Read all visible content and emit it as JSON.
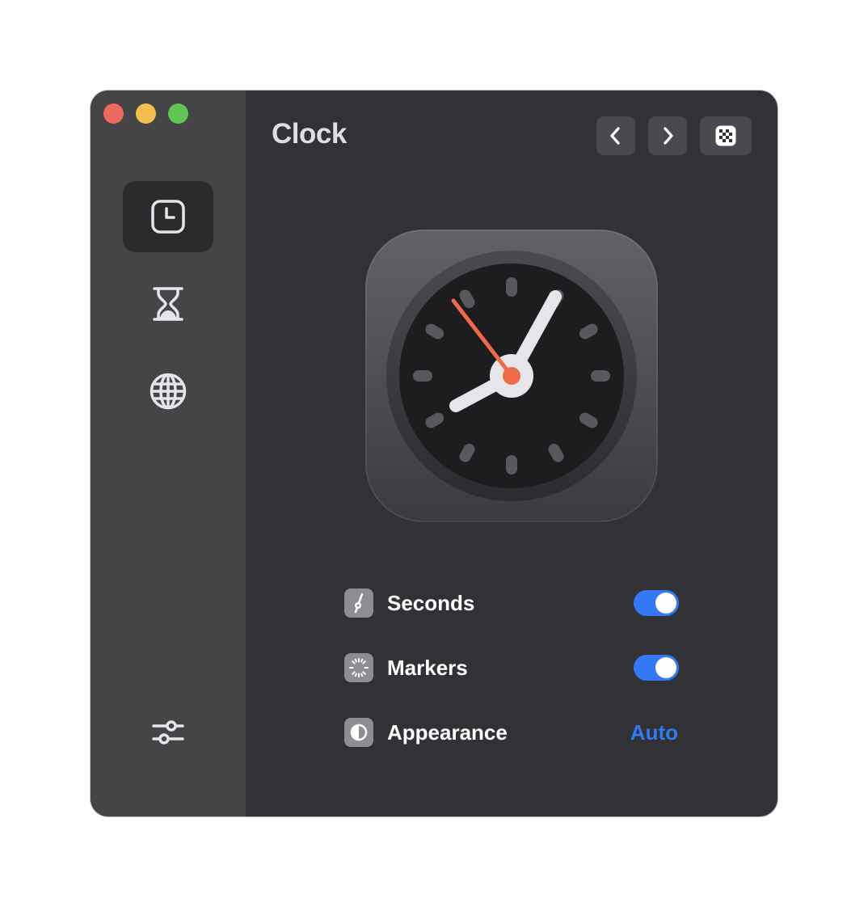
{
  "window": {
    "title": "Clock",
    "traffic_lights": [
      "close",
      "minimize",
      "zoom"
    ]
  },
  "sidebar": {
    "items": [
      {
        "name": "clock",
        "icon": "clock-icon",
        "active": true
      },
      {
        "name": "timer",
        "icon": "hourglass-icon",
        "active": false
      },
      {
        "name": "world-clock",
        "icon": "globe-icon",
        "active": false
      }
    ],
    "footer_icon": "sliders-icon"
  },
  "toolbar": {
    "buttons": [
      "chevron-left-icon",
      "chevron-right-icon",
      "checkerboard-icon"
    ]
  },
  "clock_preview": {
    "time": "8:06:51",
    "second_hand_color": "#ee6a4b"
  },
  "settings": {
    "seconds": {
      "label": "Seconds",
      "icon": "seconds-hand-icon",
      "enabled": true
    },
    "markers": {
      "label": "Markers",
      "icon": "markers-icon",
      "enabled": true
    },
    "appearance": {
      "label": "Appearance",
      "icon": "contrast-icon",
      "value": "Auto"
    }
  },
  "colors": {
    "accent": "#3478f6",
    "window_bg": "#323136",
    "sidebar_bg": "#454447"
  }
}
